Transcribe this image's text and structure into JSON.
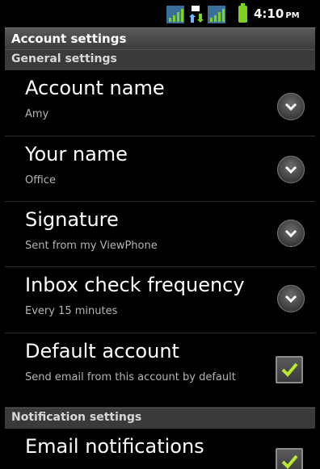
{
  "status_bar": {
    "time": "4:10",
    "ampm": "PM",
    "signal1_icon": "signal-bars-icon",
    "data_icon": "data-transfer-icon",
    "signal2_icon": "signal-bars-icon",
    "battery_icon": "battery-icon",
    "battery_color": "#7ed321"
  },
  "title_bar": {
    "title": "Account settings"
  },
  "sections": {
    "general": "General settings",
    "notification": "Notification settings"
  },
  "settings": {
    "account_name": {
      "title": "Account name",
      "summary": "Amy"
    },
    "your_name": {
      "title": "Your name",
      "summary": "Office"
    },
    "signature": {
      "title": "Signature",
      "summary": "Sent from my ViewPhone"
    },
    "inbox_check": {
      "title": "Inbox check frequency",
      "summary": "Every 15 minutes"
    },
    "default_account": {
      "title": "Default account",
      "summary": "Send email from this account by default",
      "checked": true
    },
    "email_notifications": {
      "title": "Email notifications",
      "checked": true
    }
  },
  "colors": {
    "check_color": "#b8e830",
    "background": "#000000",
    "section_bg": "#3a3a3a"
  }
}
